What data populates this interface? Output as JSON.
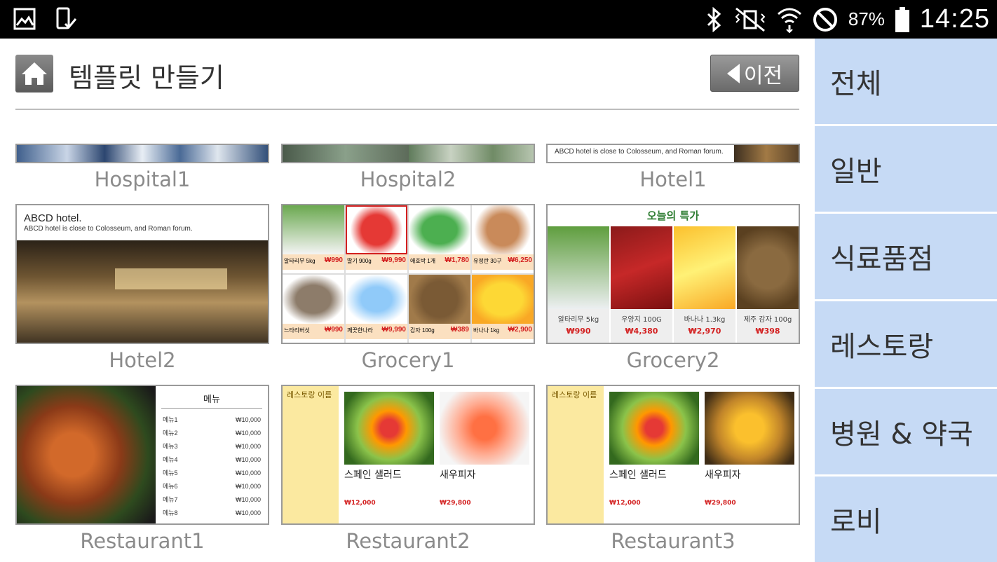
{
  "status_bar": {
    "battery_percent": "87%",
    "time": "14:25",
    "icons": [
      "gallery-icon",
      "device-check-icon",
      "bluetooth-icon",
      "vibrate-mute-icon",
      "wifi-icon",
      "do-not-disturb-icon",
      "battery-icon"
    ]
  },
  "header": {
    "title": "템플릿 만들기",
    "back_label": "이전"
  },
  "templates": [
    {
      "label": "Hospital1"
    },
    {
      "label": "Hospital2"
    },
    {
      "label": "Hotel1",
      "caption": "ABCD hotel is close to Colosseum, and Roman forum."
    },
    {
      "label": "Hotel2",
      "title": "ABCD hotel.",
      "caption": "ABCD hotel is close to Colosseum, and Roman forum."
    },
    {
      "label": "Grocery1",
      "items": [
        {
          "name": "알타리무 5kg",
          "price": "₩990"
        },
        {
          "name": "딸기 900g",
          "price": "₩9,990"
        },
        {
          "name": "애호박 1개",
          "price": "₩1,780"
        },
        {
          "name": "유정란 30구",
          "price": "₩6,250"
        },
        {
          "name": "느타리버섯",
          "price": "₩990"
        },
        {
          "name": "깨끗한나라",
          "price": "₩9,990"
        },
        {
          "name": "감자 100g",
          "price": "₩389"
        },
        {
          "name": "바나나 1kg",
          "price": "₩2,900"
        }
      ]
    },
    {
      "label": "Grocery2",
      "title": "오늘의 특가",
      "items": [
        {
          "name": "알타리무 5kg",
          "price": "₩990"
        },
        {
          "name": "우양지 100G",
          "price": "₩4,380"
        },
        {
          "name": "바나나 1.3kg",
          "price": "₩2,970"
        },
        {
          "name": "제주 감자 100g",
          "price": "₩398"
        }
      ]
    },
    {
      "label": "Restaurant1",
      "menu_title": "메뉴",
      "menu": [
        {
          "name": "메뉴1",
          "price": "₩10,000"
        },
        {
          "name": "메뉴2",
          "price": "₩10,000"
        },
        {
          "name": "메뉴3",
          "price": "₩10,000"
        },
        {
          "name": "메뉴4",
          "price": "₩10,000"
        },
        {
          "name": "메뉴5",
          "price": "₩10,000"
        },
        {
          "name": "메뉴6",
          "price": "₩10,000"
        },
        {
          "name": "메뉴7",
          "price": "₩10,000"
        },
        {
          "name": "메뉴8",
          "price": "₩10,000"
        }
      ]
    },
    {
      "label": "Restaurant2",
      "restaurant_name": "레스토랑 이름",
      "dishes": [
        {
          "name": "스페인 샐러드",
          "price": "₩12,000"
        },
        {
          "name": "새우피자",
          "price": "₩29,800"
        }
      ]
    },
    {
      "label": "Restaurant3",
      "restaurant_name": "레스토랑 이름",
      "dishes": [
        {
          "name": "스페인 샐러드",
          "price": "₩12,000"
        },
        {
          "name": "새우피자",
          "price": "₩29,800"
        }
      ]
    }
  ],
  "sidebar": {
    "items": [
      {
        "label": "전체"
      },
      {
        "label": "일반"
      },
      {
        "label": "식료품점"
      },
      {
        "label": "레스토랑"
      },
      {
        "label": "병원 & 약국"
      },
      {
        "label": "로비"
      }
    ]
  },
  "colors": {
    "sidebar_bg": "#c6daf5",
    "price_red": "#d32020",
    "grocery_green": "#2e7d32",
    "restaurant_yellow": "#fbe9a0"
  }
}
